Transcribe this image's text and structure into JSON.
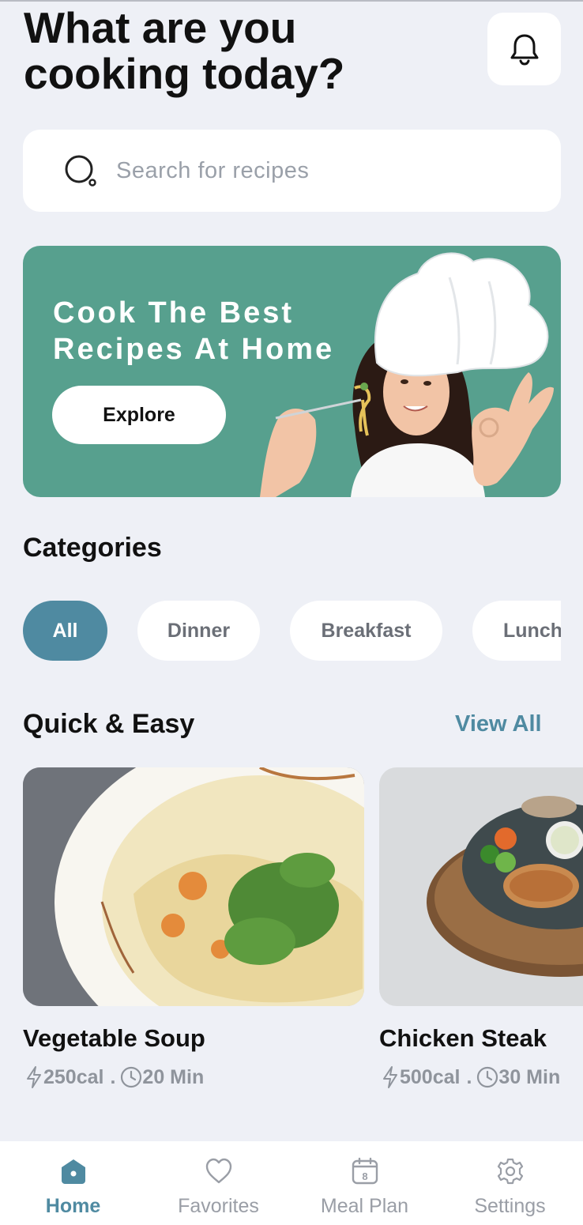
{
  "header": {
    "title": "What are you cooking today?"
  },
  "search": {
    "placeholder": "Search for recipes"
  },
  "banner": {
    "title": "Cook The Best Recipes At Home",
    "button_label": "Explore"
  },
  "categories": {
    "title": "Categories",
    "items": [
      "All",
      "Dinner",
      "Breakfast",
      "Lunch"
    ],
    "selected": "All"
  },
  "quick_easy": {
    "title": "Quick & Easy",
    "view_all_label": "View All",
    "recipes": [
      {
        "name": "Vegetable Soup",
        "calories": "250cal",
        "separator": ".",
        "time": "20 Min"
      },
      {
        "name": "Chicken Steak",
        "calories": "500cal",
        "separator": ".",
        "time": "30 Min"
      }
    ]
  },
  "tabbar": {
    "items": [
      {
        "label": "Home",
        "icon": "home-icon",
        "active": true
      },
      {
        "label": "Favorites",
        "icon": "heart-icon",
        "active": false
      },
      {
        "label": "Meal Plan",
        "icon": "calendar-icon",
        "active": false,
        "badge": "8"
      },
      {
        "label": "Settings",
        "icon": "gear-icon",
        "active": false
      }
    ]
  },
  "colors": {
    "background": "#eef0f6",
    "banner": "#57a08e",
    "accent": "#4f8aa1",
    "muted_text": "#8f949c"
  }
}
